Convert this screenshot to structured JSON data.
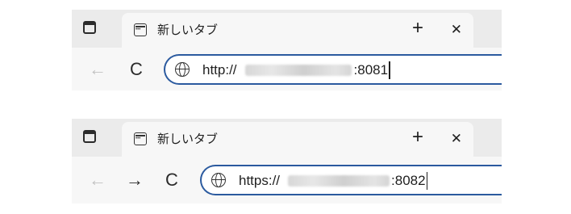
{
  "browsers": [
    {
      "tab": {
        "title": "新しいタブ",
        "close_glyph": "✕",
        "favicon": "new-tab-page-icon"
      },
      "new_tab_glyph": "+",
      "nav": {
        "back_glyph": "←",
        "reload_glyph": "C"
      },
      "address": {
        "scheme": "http://",
        "port": ":8081",
        "host_redacted": true
      }
    },
    {
      "tab": {
        "title": "新しいタブ",
        "close_glyph": "✕",
        "favicon": "new-tab-page-icon"
      },
      "new_tab_glyph": "+",
      "nav": {
        "back_glyph": "←",
        "forward_glyph": "→",
        "reload_glyph": "C"
      },
      "address": {
        "scheme": "https://",
        "port": ":8082",
        "host_redacted": true
      }
    }
  ],
  "colors": {
    "tabstrip_bg": "#ebebeb",
    "toolbar_bg": "#f7f7f7",
    "address_focus_border": "#2b5a9f",
    "disabled_icon": "#c2c2c2"
  }
}
